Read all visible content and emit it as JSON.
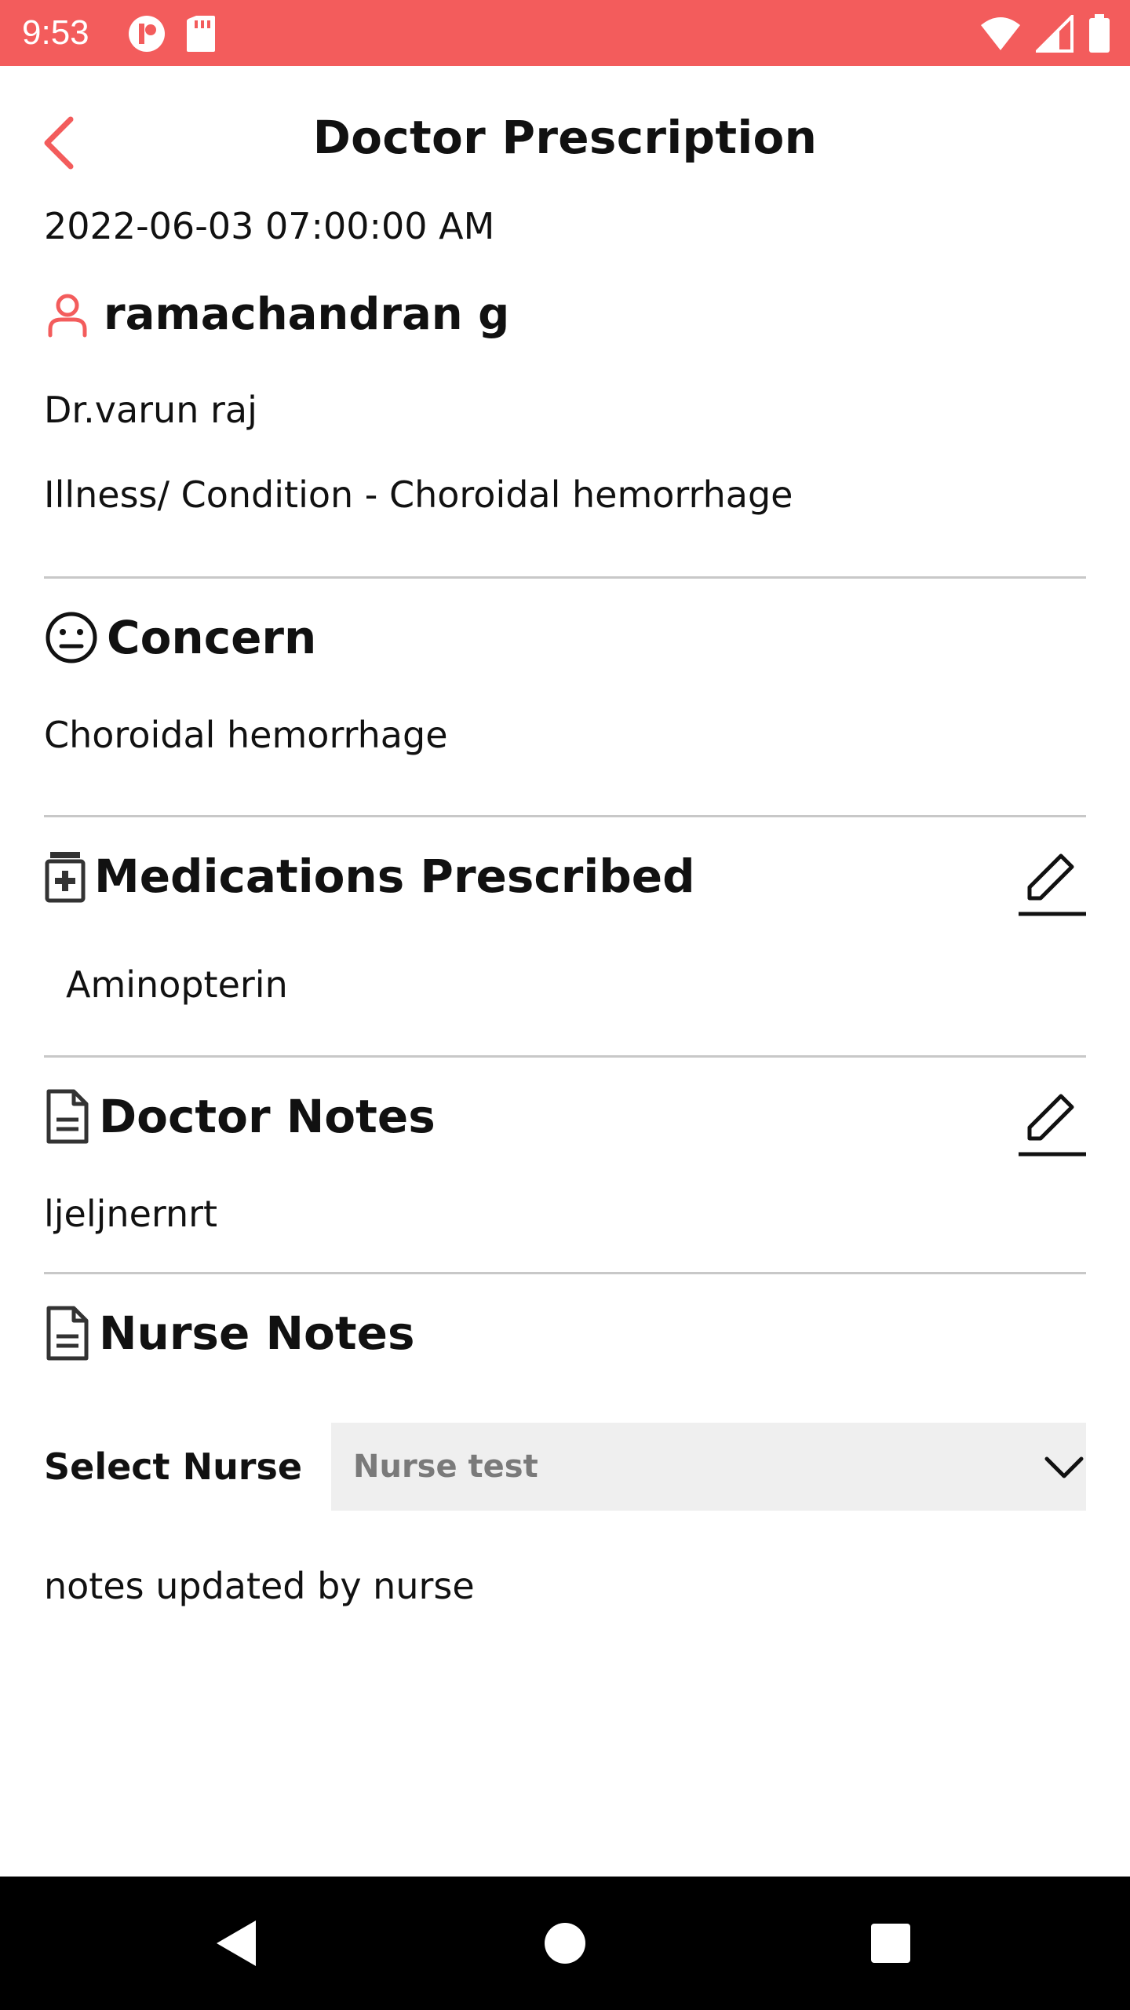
{
  "status_bar": {
    "time": "9:53",
    "icons_left": [
      "app-notification-icon",
      "sd-card-icon"
    ],
    "icons_right": [
      "wifi-icon",
      "cellular-signal-icon",
      "battery-icon"
    ],
    "color": "#f35c5c"
  },
  "header": {
    "title": "Doctor Prescription",
    "back_icon": "chevron-left-icon"
  },
  "prescription": {
    "datetime": "2022-06-03 07:00:00 AM",
    "patient_name": "ramachandran g",
    "doctor": "Dr.varun raj",
    "illness": "Illness/ Condition - Choroidal hemorrhage"
  },
  "concern": {
    "title": "Concern",
    "text": "Choroidal hemorrhage"
  },
  "medications": {
    "title": "Medications Prescribed",
    "items": [
      "Aminopterin"
    ]
  },
  "doctor_notes": {
    "title": "Doctor Notes",
    "text": "ljeljnernrt"
  },
  "nurse_notes": {
    "title": "Nurse Notes",
    "select_label": "Select Nurse",
    "selected_nurse": "Nurse test",
    "text": "notes updated by nurse"
  },
  "colors": {
    "accent": "#f35c5c",
    "divider": "#c8c8c8",
    "select_bg": "#efefef"
  }
}
